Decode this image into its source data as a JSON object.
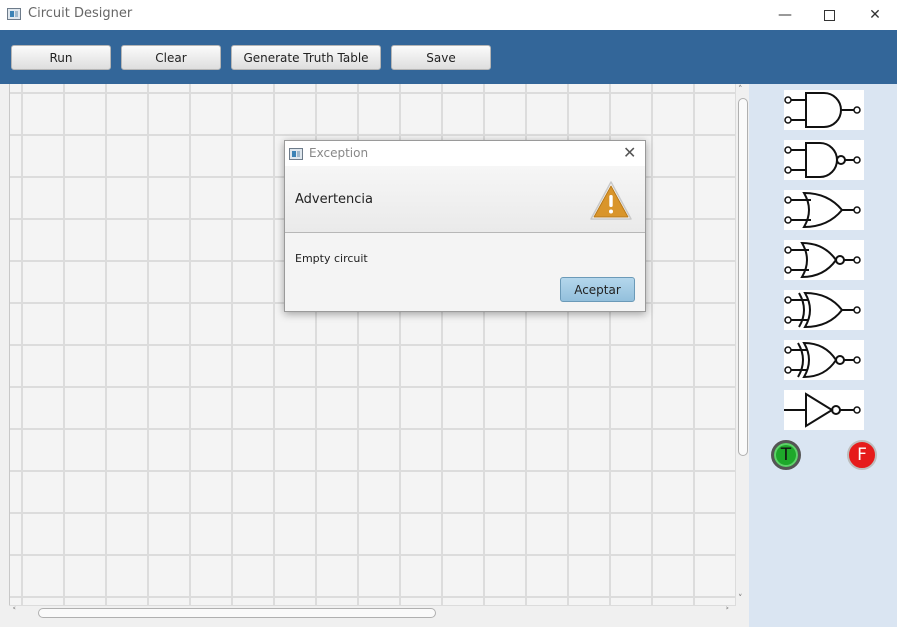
{
  "window": {
    "title": "Circuit Designer",
    "minimize_glyph": "—",
    "close_glyph": "✕"
  },
  "toolbar": {
    "buttons": [
      {
        "label": "Run"
      },
      {
        "label": "Clear"
      },
      {
        "label": "Generate Truth Table"
      },
      {
        "label": "Save"
      }
    ],
    "background_color": "#336699"
  },
  "palette": {
    "gates": [
      {
        "icon": "and-gate-icon"
      },
      {
        "icon": "nand-gate-icon"
      },
      {
        "icon": "or-gate-icon"
      },
      {
        "icon": "nor-gate-icon"
      },
      {
        "icon": "xor-gate-icon"
      },
      {
        "icon": "xnor-gate-icon"
      },
      {
        "icon": "not-gate-icon"
      }
    ],
    "true_input": {
      "label": "T",
      "color": "#1ea82a"
    },
    "false_input": {
      "label": "F",
      "color": "#e61b1b"
    },
    "background_color": "#dae5f2"
  },
  "scrollbars": {
    "up_arrow": "˄",
    "down_arrow": "˅",
    "left_arrow": "˂",
    "right_arrow": "˃"
  },
  "dialog": {
    "title": "Exception",
    "close_glyph": "✕",
    "heading": "Advertencia",
    "message": "Empty circuit",
    "ok_label": "Aceptar",
    "warning_color": "#d9952b"
  }
}
